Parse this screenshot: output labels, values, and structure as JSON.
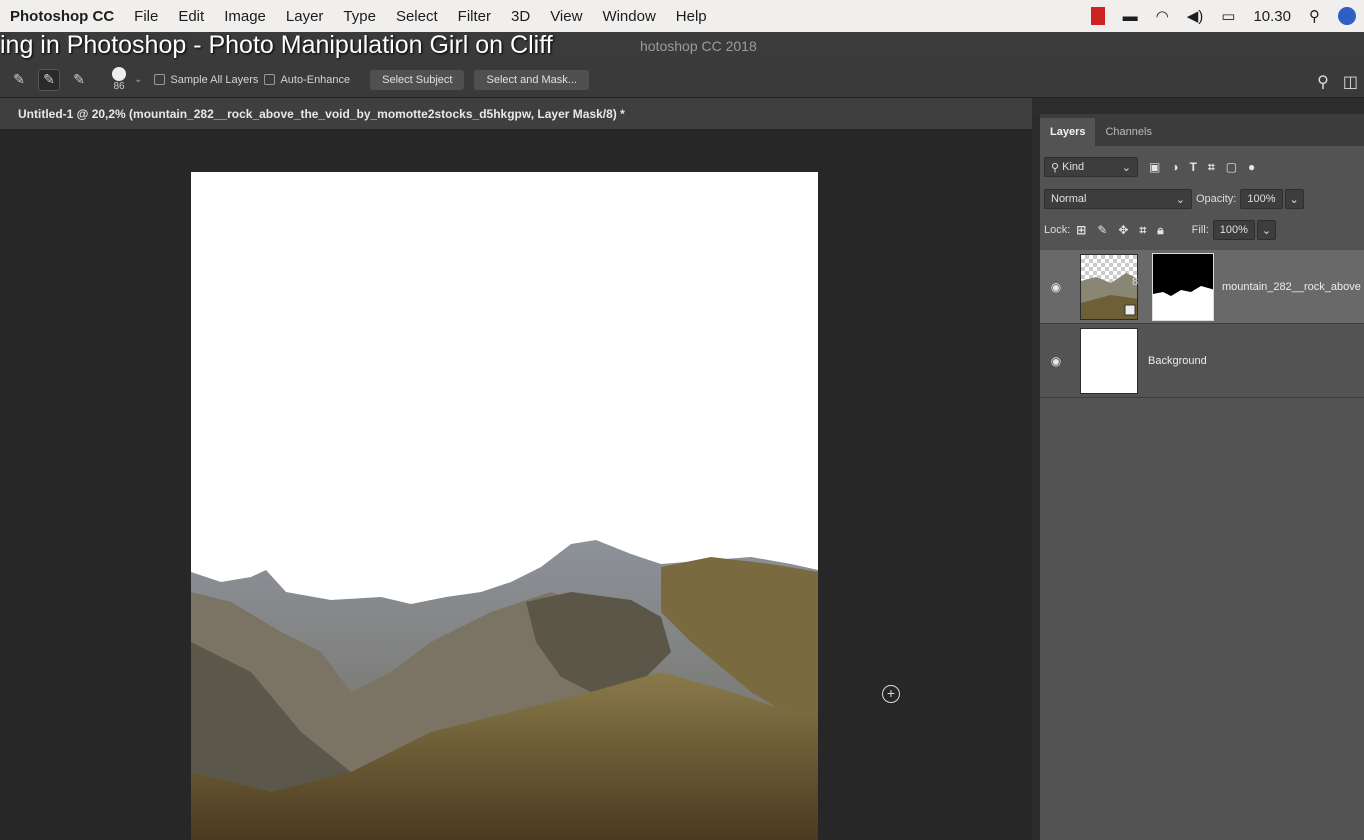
{
  "menubar": {
    "app_name": "Photoshop CC",
    "items": [
      "File",
      "Edit",
      "Image",
      "Layer",
      "Type",
      "Select",
      "Filter",
      "3D",
      "View",
      "Window",
      "Help"
    ],
    "clock": "10.30",
    "status_icons": [
      "record-icon",
      "display-icon",
      "wifi-icon",
      "volume-icon",
      "battery-icon",
      "search-icon",
      "user-icon"
    ]
  },
  "video_title": "ing in Photoshop - Photo Manipulation Girl on Cliff",
  "window_title": "hotoshop CC 2018",
  "options_bar": {
    "brush_size": "86",
    "sample_all_layers": "Sample All Layers",
    "auto_enhance": "Auto-Enhance",
    "select_subject": "Select Subject",
    "select_and_mask": "Select and Mask..."
  },
  "document": {
    "tab_label": "Untitled-1 @ 20,2% (mountain_282__rock_above_the_void_by_momotte2stocks_d5hkgpw, Layer Mask/8) *"
  },
  "layers_panel": {
    "tabs": [
      "Layers",
      "Channels"
    ],
    "filter_kind": "Kind",
    "blend_mode": "Normal",
    "opacity_label": "Opacity:",
    "opacity_value": "100%",
    "lock_label": "Lock:",
    "fill_label": "Fill:",
    "fill_value": "100%",
    "layers": [
      {
        "name": "mountain_282__rock_above",
        "selected": true
      },
      {
        "name": "Background",
        "selected": false
      }
    ]
  },
  "colors": {
    "panel_bg": "#535353",
    "workspace_bg": "#272727",
    "selected_layer": "#696969"
  }
}
